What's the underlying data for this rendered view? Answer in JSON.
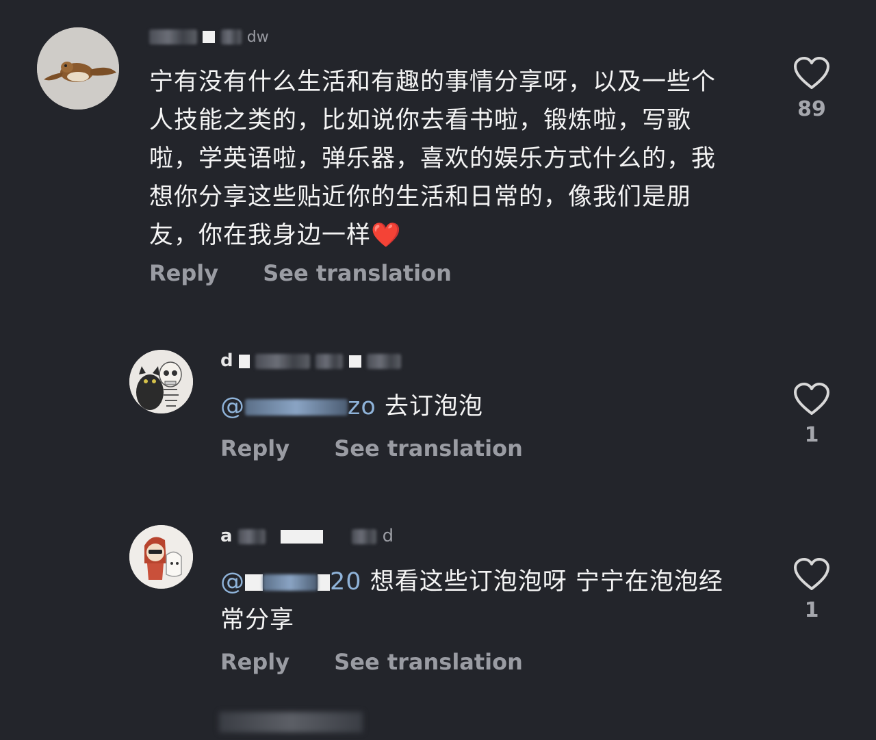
{
  "comments": [
    {
      "username_visible": "dw",
      "text": "宁有没有什么生活和有趣的事情分享呀，以及一些个人技能之类的，比如说你去看书啦，锻炼啦，写歌啦，学英语啦，弹乐器，喜欢的娱乐方式什么的，我想你分享这些贴近你的生活和日常的，像我们是朋友，你在我身边一样",
      "emoji": "❤️",
      "reply_label": "Reply",
      "translate_label": "See translation",
      "likes": "89",
      "avatar_icon": "turtle-avatar"
    },
    {
      "username_visible": "d",
      "mention_visible": "@",
      "mention_tail": "zo",
      "text": "去订泡泡",
      "reply_label": "Reply",
      "translate_label": "See translation",
      "likes": "1",
      "avatar_icon": "cat-skeleton-avatar"
    },
    {
      "username_visible": "a",
      "username_tail": "d",
      "mention_visible": "@",
      "mention_tail": "20",
      "text": "想看这些订泡泡呀 宁宁在泡泡经常分享",
      "reply_label": "Reply",
      "translate_label": "See translation",
      "likes": "1",
      "avatar_icon": "cartoon-girl-avatar"
    }
  ],
  "colors": {
    "background": "#23252b",
    "text": "#f4f4f4",
    "action": "#9a9ca3",
    "heart_outline": "#d8d8d8"
  }
}
